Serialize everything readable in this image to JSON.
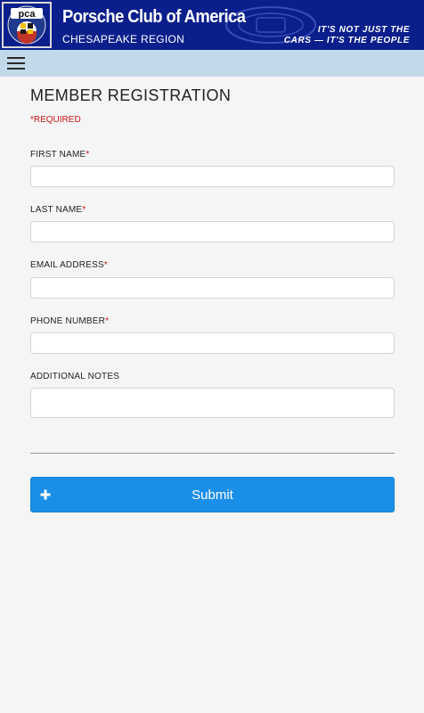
{
  "header": {
    "logo_text": "pca",
    "title": "Porsche Club of America",
    "subtitle": "CHESAPEAKE REGION",
    "tagline_1": "IT'S NOT JUST THE",
    "tagline_2": "CARS — IT'S THE PEOPLE",
    "colors": {
      "banner": "#0b1f8c",
      "nav": "#c2d9ea"
    }
  },
  "nav": {
    "menu_icon": "hamburger-icon"
  },
  "form": {
    "title": "MEMBER REGISTRATION",
    "required_note": "*REQUIRED",
    "fields": [
      {
        "label": "FIRST NAME",
        "required": "*",
        "value": "",
        "placeholder": ""
      },
      {
        "label": "LAST NAME",
        "required": "*",
        "value": "",
        "placeholder": ""
      },
      {
        "label": "EMAIL ADDRESS",
        "required": "*",
        "value": "",
        "placeholder": ""
      },
      {
        "label": "PHONE NUMBER",
        "required": "*",
        "value": "",
        "placeholder": ""
      },
      {
        "label": "ADDITIONAL NOTES",
        "value": "",
        "placeholder": ""
      }
    ],
    "submit_label": "Submit",
    "submit_icon": "plus-icon",
    "colors": {
      "submit": "#1a8fe8",
      "required": "#c81414"
    }
  }
}
